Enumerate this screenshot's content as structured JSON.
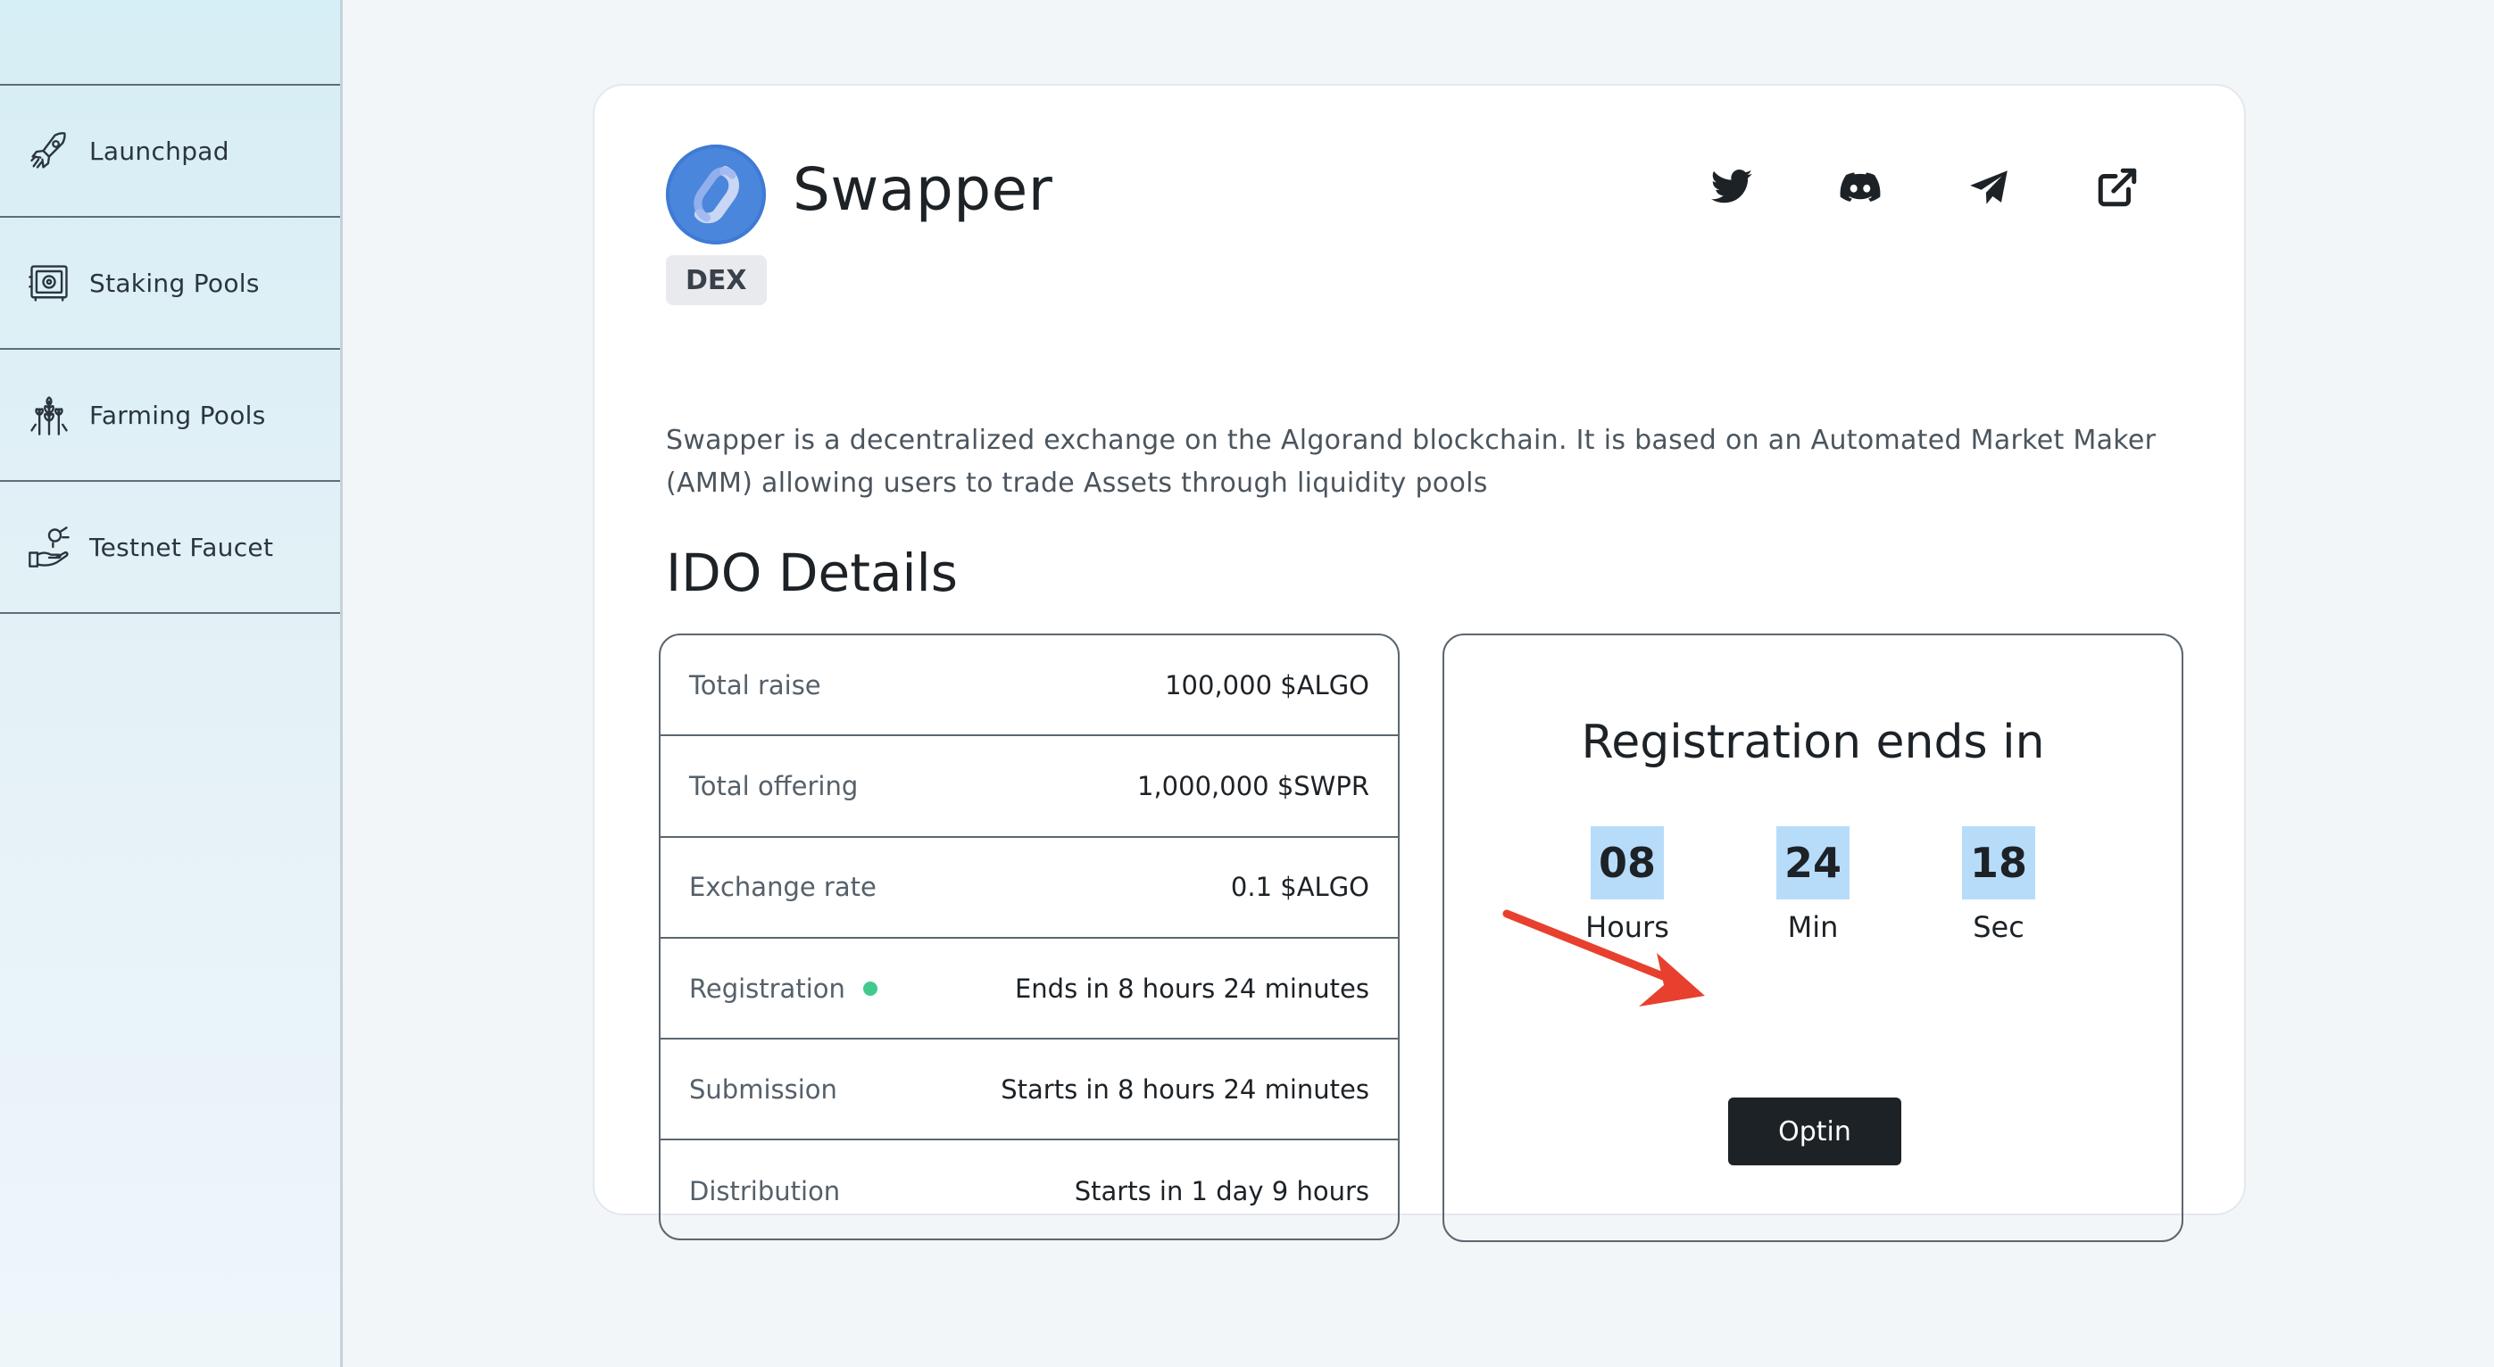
{
  "sidebar": {
    "items": [
      {
        "label": "Launchpad",
        "icon": "rocket-icon"
      },
      {
        "label": "Staking Pools",
        "icon": "safe-icon"
      },
      {
        "label": "Farming Pools",
        "icon": "wheat-icon"
      },
      {
        "label": "Testnet Faucet",
        "icon": "hand-coin-icon"
      }
    ]
  },
  "project": {
    "name": "Swapper",
    "tag": "DEX",
    "description": "Swapper is a decentralized exchange on the Algorand blockchain. It is based on an Automated Market Maker (AMM) allowing users to trade Assets through liquidity pools",
    "socials": [
      "twitter-icon",
      "discord-icon",
      "telegram-icon",
      "external-link-icon"
    ]
  },
  "ido": {
    "title": "IDO Details",
    "rows": [
      {
        "label": "Total raise",
        "value": "100,000 $ALGO"
      },
      {
        "label": "Total offering",
        "value": "1,000,000 $SWPR"
      },
      {
        "label": "Exchange rate",
        "value": "0.1 $ALGO"
      },
      {
        "label": "Registration",
        "value": "Ends in 8 hours 24 minutes",
        "status": "active"
      },
      {
        "label": "Submission",
        "value": "Starts in 8 hours 24 minutes"
      },
      {
        "label": "Distribution",
        "value": "Starts in 1 day 9 hours"
      }
    ]
  },
  "countdown": {
    "title": "Registration ends in",
    "hours": "08",
    "hours_label": "Hours",
    "minutes": "24",
    "minutes_label": "Min",
    "seconds": "18",
    "seconds_label": "Sec",
    "button_label": "Optin"
  },
  "colors": {
    "accent_dark": "#1d2227",
    "timer_bg": "#b7dcf9",
    "status_green": "#41c98e",
    "arrow_red": "#e8402e",
    "logo_blue": "#4a86dc"
  }
}
